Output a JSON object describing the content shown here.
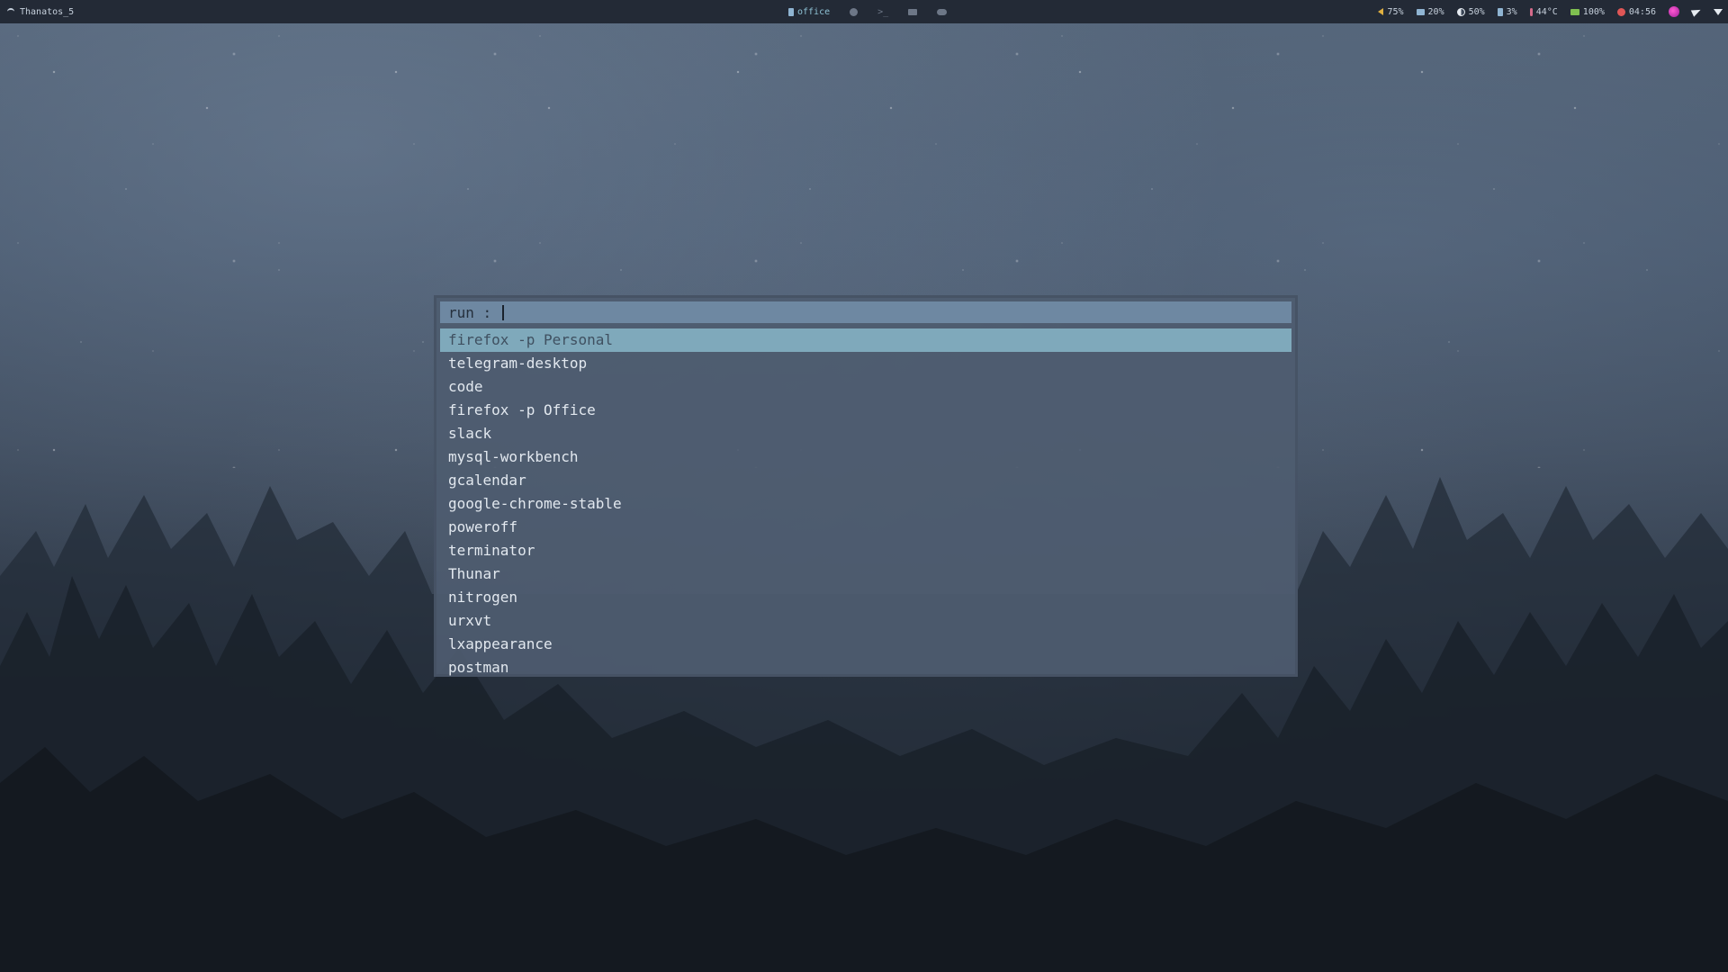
{
  "topbar": {
    "hostname": "Thanatos_5",
    "workspaces": [
      {
        "label": "office",
        "icon": "document-icon",
        "active": true
      },
      {
        "label": "",
        "icon": "globe-icon",
        "active": false
      },
      {
        "label": "",
        "icon": "terminal-icon",
        "active": false
      },
      {
        "label": "",
        "icon": "folder-icon",
        "active": false
      },
      {
        "label": "",
        "icon": "cloud-icon",
        "active": false
      }
    ],
    "status": {
      "volume": "75%",
      "memory": "20%",
      "brightness": "50%",
      "disk": "3%",
      "temperature": "44°C",
      "battery": "100%",
      "clock": "04:56"
    },
    "colors": {
      "bar_bg": "#232a36",
      "active_workspace": "#8fc3d6",
      "volume_icon": "#e0b040",
      "battery_icon": "#7fc050",
      "clock_icon": "#e05656",
      "temperature_icon": "#d46a8a"
    }
  },
  "launcher": {
    "prompt": "run : ",
    "input_value": "",
    "selected_index": 0,
    "items": [
      "firefox -p Personal",
      "telegram-desktop",
      "code",
      "firefox -p Office",
      "slack",
      "mysql-workbench",
      "gcalendar",
      "google-chrome-stable",
      "poweroff",
      "terminator",
      "Thunar",
      "nitrogen",
      "urxvt",
      "lxappearance",
      "postman"
    ],
    "colors": {
      "prompt_bg": "#6e88a2",
      "selected_bg": "#7fa9bb",
      "panel_bg": "#4e5c70",
      "text": "#e2e8ef"
    }
  }
}
